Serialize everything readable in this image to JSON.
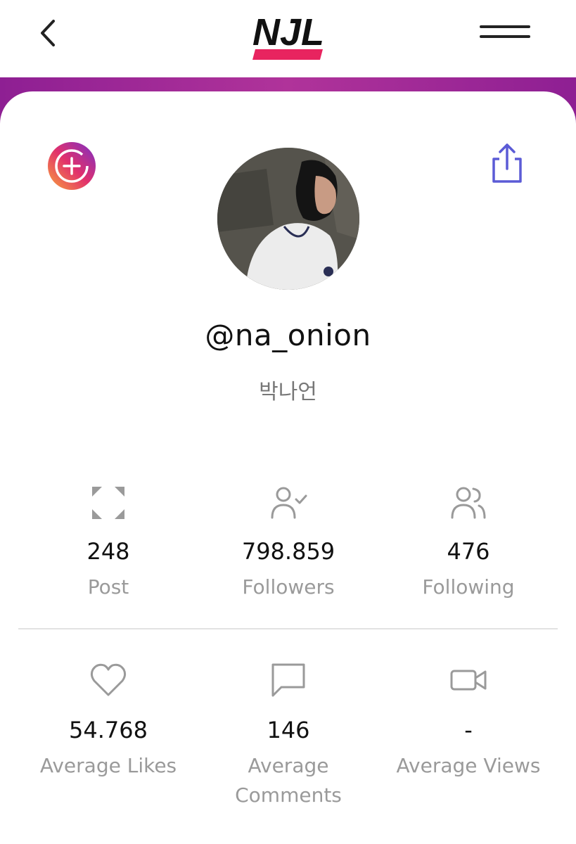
{
  "header": {
    "back_icon": "chevron-left-icon",
    "logo_text": "NJL",
    "menu_icon": "hamburger-menu-icon"
  },
  "colors": {
    "band": "#9a2796",
    "logo_accent": "#e8245f",
    "share_icon": "#5b5bd6",
    "story_gradient": [
      "#f9a23b",
      "#e1306c",
      "#7a2fc8"
    ]
  },
  "profile": {
    "username": "@na_onion",
    "real_name": "박나언"
  },
  "stats": [
    {
      "icon": "expand-icon",
      "value": "248",
      "label": "Post"
    },
    {
      "icon": "user-check-icon",
      "value": "798.859",
      "label": "Followers"
    },
    {
      "icon": "users-icon",
      "value": "476",
      "label": "Following"
    }
  ],
  "engagement": [
    {
      "icon": "heart-icon",
      "value": "54.768",
      "label": "Average Likes"
    },
    {
      "icon": "comment-icon",
      "value": "146",
      "label_line1": "Average",
      "label_line2": "Comments"
    },
    {
      "icon": "video-icon",
      "value": "-",
      "label": "Average Views"
    }
  ]
}
